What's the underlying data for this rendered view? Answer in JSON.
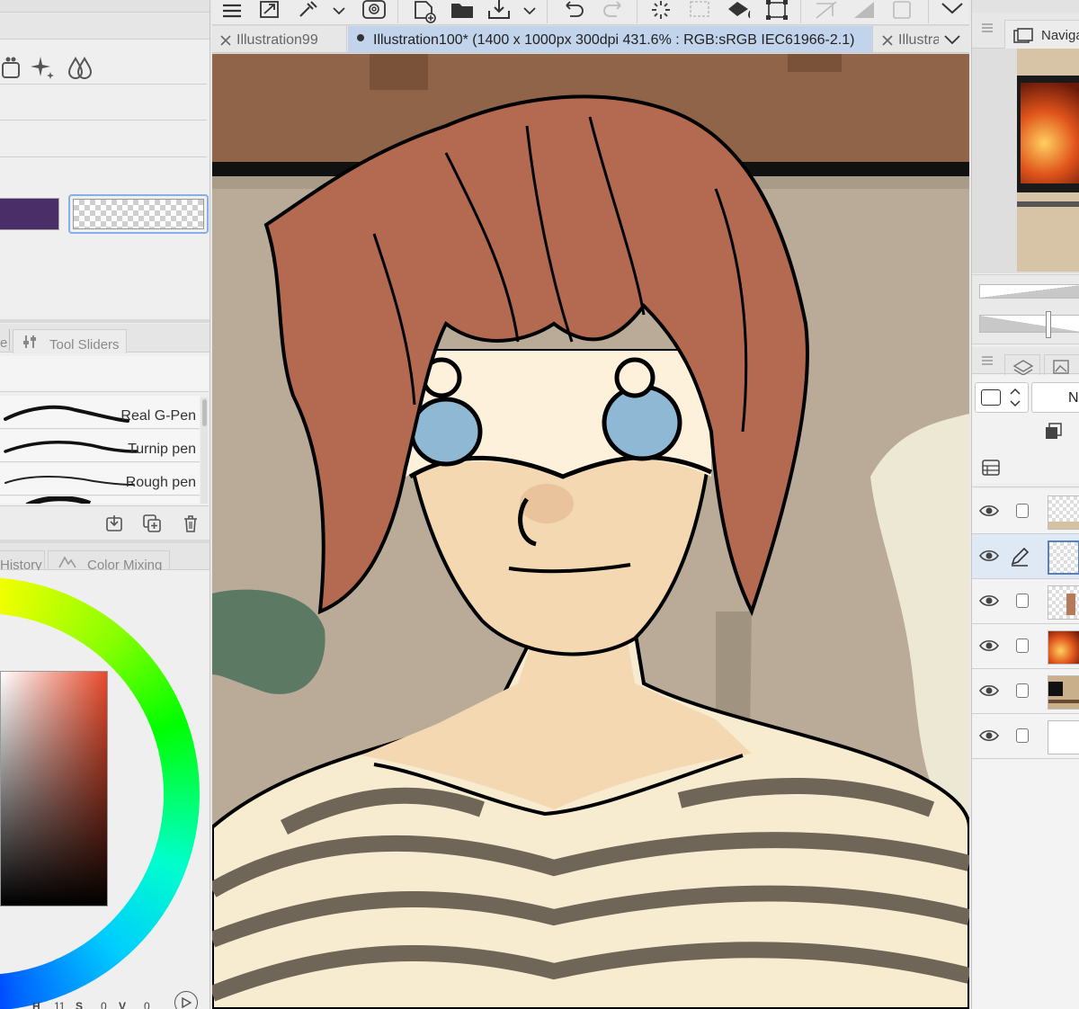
{
  "left_panel": {
    "sub_tool_tabs": {
      "partial_tab": "e",
      "tool_sliders": "Tool Sliders"
    },
    "color_swatches": {
      "main_color": "#4a2e68",
      "sub_color": "transparent"
    },
    "brushes": [
      {
        "name": "Real G-Pen"
      },
      {
        "name": "Turnip pen"
      },
      {
        "name": "Rough pen"
      }
    ],
    "color_tabs": {
      "history": "History",
      "color_mixing": "Color Mixing"
    },
    "color_values": {
      "h_label": "H",
      "h_value": "11",
      "s_label": "S",
      "s_value": "0",
      "v_label": "V",
      "v_value": "0"
    }
  },
  "document_tabs": [
    {
      "label": "Illustration99",
      "active": false
    },
    {
      "label": "Illustration100* (1400 x 1000px 300dpi 431.6% : RGB:sRGB IEC61966-2.1)",
      "active": true
    },
    {
      "label": "Illustra",
      "active": false
    }
  ],
  "right_panel": {
    "navigator_title": "Naviga",
    "blend_mode_partial": "N"
  },
  "colors": {
    "hair": "#b46a50",
    "skin": "#f4d8b2",
    "wall": "#b9ab97",
    "shelf": "#8f6449",
    "shirt": "#f8ecd0",
    "stripe": "#6f6658",
    "eye": "#8fb8d4",
    "accent_green": "#5c7a63"
  }
}
